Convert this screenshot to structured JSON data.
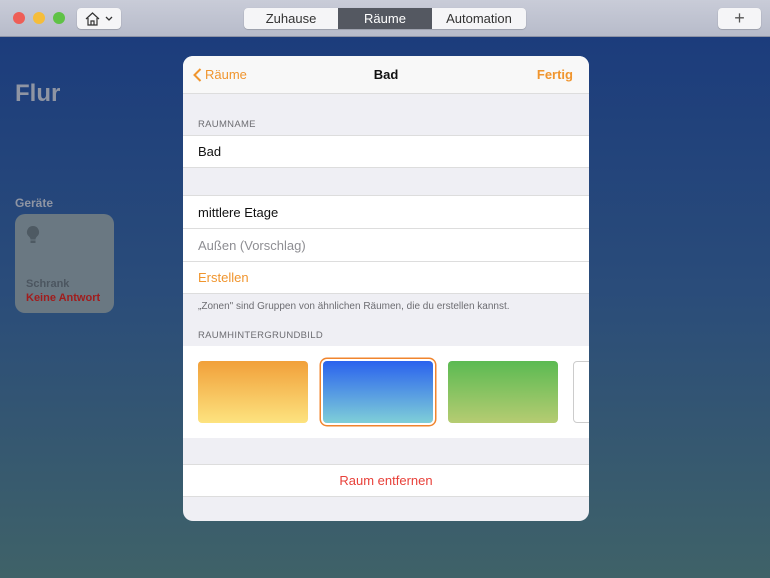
{
  "toolbar": {
    "home_icon": "house-icon",
    "tabs": [
      {
        "label": "Zuhause"
      },
      {
        "label": "Räume",
        "active": true
      },
      {
        "label": "Automation"
      }
    ],
    "add_label": "+"
  },
  "background": {
    "room_title": "Flur",
    "devices_label": "Geräte",
    "device": {
      "name": "Schrank",
      "status": "Keine Antwort",
      "icon": "lightbulb-icon"
    }
  },
  "modal": {
    "back_label": "Räume",
    "title": "Bad",
    "done_label": "Fertig",
    "room_name_header": "RAUMNAME",
    "room_name_value": "Bad",
    "zones": [
      {
        "label": "mittlere Etage"
      },
      {
        "label": "Außen (Vorschlag)"
      }
    ],
    "create_label": "Erstellen",
    "zones_footer": "„Zonen\" sind Gruppen von ähnlichen Räumen, die du erstellen kannst.",
    "wallpaper_header": "RAUMHINTERGRUNDBILD",
    "wallpapers": [
      {
        "name": "orange",
        "colors": [
          "#f1a03a",
          "#fde37f"
        ]
      },
      {
        "name": "blue",
        "colors": [
          "#2a62ee",
          "#7fcfd8"
        ],
        "selected": true
      },
      {
        "name": "green",
        "colors": [
          "#5bba52",
          "#b6cc72"
        ]
      }
    ],
    "remove_label": "Raum entfernen"
  },
  "colors": {
    "accent": "#f0952e",
    "destructive": "#e8413a"
  }
}
